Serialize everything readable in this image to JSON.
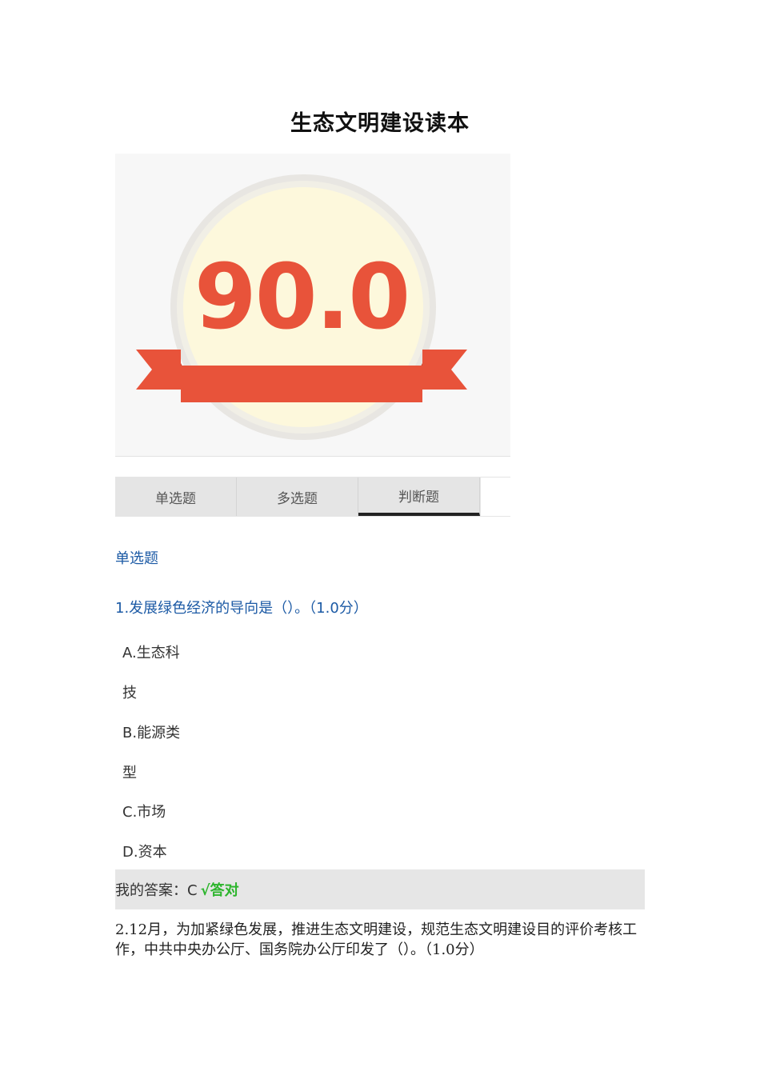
{
  "title": "生态文明建设读本",
  "score": {
    "value": "90.0",
    "colors": {
      "circle": "#fdf8dc",
      "ring": "#e8e6e2",
      "ribbon": "#e8533a",
      "ribbon_dark": "#c63e28",
      "digits": "#e8533a"
    }
  },
  "tabs": [
    {
      "label": "单选题"
    },
    {
      "label": "多选题"
    },
    {
      "label": "判断题"
    }
  ],
  "section_heading": "单选题",
  "question1": {
    "text": "1.发展绿色经济的导向是（）。（1.0分）",
    "options": [
      "A.生态科",
      "技",
      "B.能源类",
      "型",
      "C.市场",
      "D.资本"
    ]
  },
  "answer": {
    "label": "我的答案：C",
    "result": "√答对"
  },
  "question2": {
    "text": "2.12月，为加紧绿色发展，推进生态文明建设，规范生态文明建设目的评价考核工作，中共中央办公厅、国务院办公厅印发了（）。（1.0分）"
  }
}
